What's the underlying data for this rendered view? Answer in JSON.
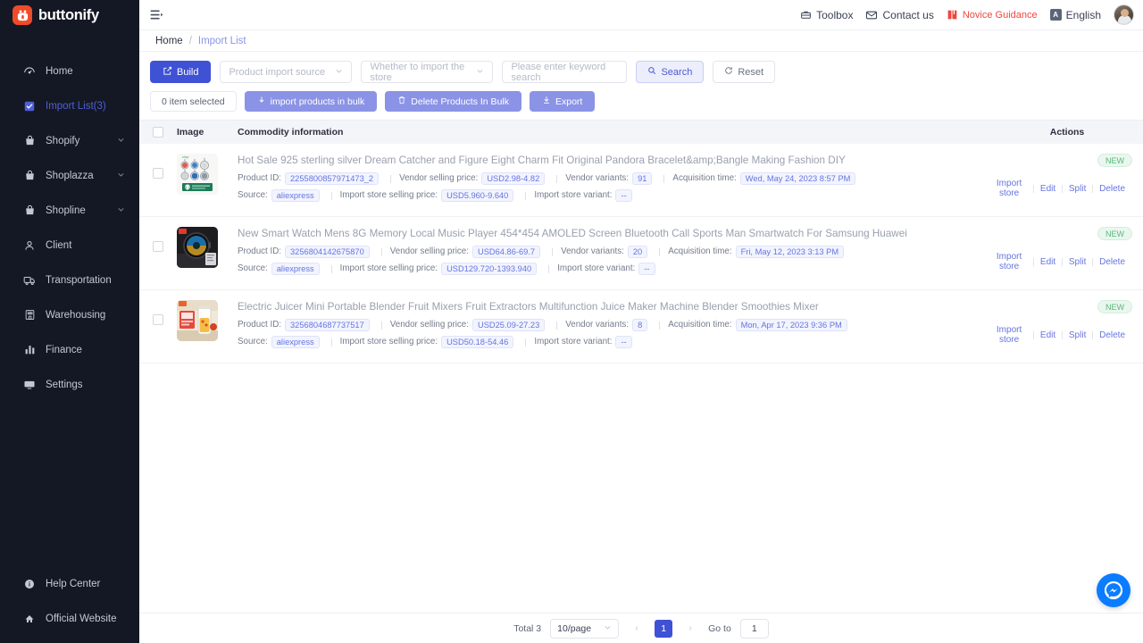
{
  "brand": {
    "name": "buttonify"
  },
  "sidebar": {
    "items": [
      {
        "label": "Home",
        "icon": "dashboard-icon",
        "active": false,
        "expandable": false
      },
      {
        "label": "Import List(3)",
        "icon": "checkbox-list-icon",
        "active": true,
        "expandable": false
      },
      {
        "label": "Shopify",
        "icon": "bag-icon",
        "active": false,
        "expandable": true
      },
      {
        "label": "Shoplazza",
        "icon": "bag-icon",
        "active": false,
        "expandable": true
      },
      {
        "label": "Shopline",
        "icon": "bag-icon",
        "active": false,
        "expandable": true
      },
      {
        "label": "Client",
        "icon": "user-icon",
        "active": false,
        "expandable": false
      },
      {
        "label": "Transportation",
        "icon": "truck-icon",
        "active": false,
        "expandable": false
      },
      {
        "label": "Warehousing",
        "icon": "warehouse-icon",
        "active": false,
        "expandable": false
      },
      {
        "label": "Finance",
        "icon": "bar-chart-icon",
        "active": false,
        "expandable": false
      },
      {
        "label": "Settings",
        "icon": "monitor-icon",
        "active": false,
        "expandable": false
      }
    ],
    "bottom_items": [
      {
        "label": "Help Center",
        "icon": "info-circle-icon"
      },
      {
        "label": "Official Website",
        "icon": "home-roof-icon"
      }
    ]
  },
  "topbar": {
    "menu_toggle": "hamburger-icon",
    "toolbox": "Toolbox",
    "contact": "Contact us",
    "novice": "Novice Guidance",
    "language": "English",
    "language_badge": "A",
    "novice_color": "#f2453d"
  },
  "breadcrumb": {
    "home": "Home",
    "separator": "/",
    "current": "Import List"
  },
  "filters": {
    "build_label": "Build",
    "source_placeholder": "Product import source",
    "store_placeholder": "Whether to import the store",
    "keyword_placeholder": "Please enter keyword search",
    "search_label": "Search",
    "reset_label": "Reset"
  },
  "bulkbar": {
    "selected_count": "0 item selected",
    "import_bulk": "import products in bulk",
    "delete_bulk": "Delete Products In Bulk",
    "export": "Export"
  },
  "table": {
    "headers": {
      "image": "Image",
      "info": "Commodity information",
      "actions": "Actions"
    },
    "labels": {
      "product_id": "Product ID:",
      "vendor_price": "Vendor selling price:",
      "vendor_variants": "Vendor variants:",
      "acquisition_time": "Acquisition time:",
      "source": "Source:",
      "import_price": "Import store selling price:",
      "import_variant": "Import store variant:"
    },
    "actions": {
      "import_store": "Import store",
      "edit": "Edit",
      "split": "Split",
      "delete": "Delete"
    },
    "badge_new": "NEW",
    "rows": [
      {
        "title": "Hot Sale 925 sterling silver Dream Catcher and Figure Eight Charm Fit Original Pandora Bracelet&amp;Bangle Making Fashion DIY",
        "product_id": "2255800857971473_2",
        "vendor_price": "USD2.98-4.82",
        "vendor_variants": "91",
        "acquisition_time": "Wed, May 24, 2023 8:57 PM",
        "source": "aliexpress",
        "import_price": "USD5.960-9.640",
        "import_variant": "--",
        "badge": "NEW",
        "thumb": "jewelry-charms-thumbnail"
      },
      {
        "title": "New Smart Watch Mens 8G Memory Local Music Player 454*454 AMOLED Screen Bluetooth Call Sports Man Smartwatch For Samsung Huawei",
        "product_id": "3256804142675870",
        "vendor_price": "USD64.86-69.7",
        "vendor_variants": "20",
        "acquisition_time": "Fri, May 12, 2023 3:13 PM",
        "source": "aliexpress",
        "import_price": "USD129.720-1393.940",
        "import_variant": "--",
        "badge": "NEW",
        "thumb": "smartwatch-thumbnail"
      },
      {
        "title": "Electric Juicer Mini Portable Blender Fruit Mixers Fruit Extractors Multifunction Juice Maker Machine Blender Smoothies Mixer",
        "product_id": "3256804687737517",
        "vendor_price": "USD25.09-27.23",
        "vendor_variants": "8",
        "acquisition_time": "Mon, Apr 17, 2023 9:36 PM",
        "source": "aliexpress",
        "import_price": "USD50.18-54.46",
        "import_variant": "--",
        "badge": "NEW",
        "thumb": "juicer-blender-thumbnail"
      }
    ]
  },
  "pagination": {
    "total": "Total 3",
    "page_size": "10/page",
    "prev": "‹",
    "current_page": "1",
    "next": "›",
    "goto_label": "Go to",
    "goto_value": "1"
  },
  "fab": {
    "icon": "messenger-icon",
    "color": "#0a7cff"
  }
}
